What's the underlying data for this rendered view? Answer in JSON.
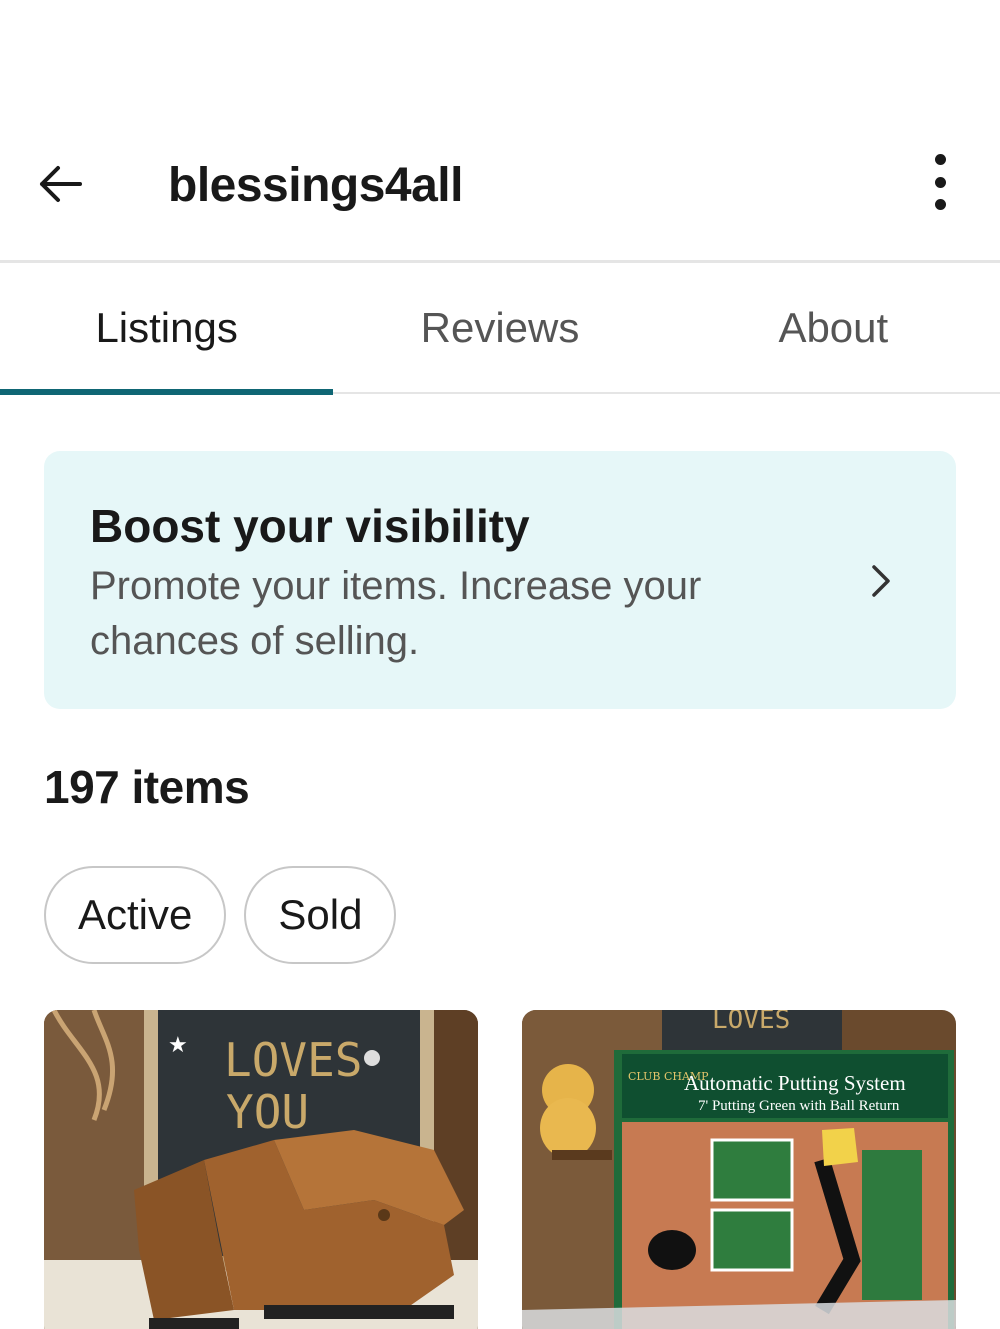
{
  "header": {
    "title": "blessings4all"
  },
  "tabs": [
    {
      "label": "Listings",
      "active": true
    },
    {
      "label": "Reviews",
      "active": false
    },
    {
      "label": "About",
      "active": false
    }
  ],
  "promo": {
    "title": "Boost your visibility",
    "description": "Promote your items. Increase your chances of selling."
  },
  "items": {
    "count_label": "197 items"
  },
  "filters": [
    {
      "label": "Active"
    },
    {
      "label": "Sold"
    }
  ],
  "listings": [
    {
      "image": "brown leather boots in front of letter board",
      "board_text": "LOVES YOU"
    },
    {
      "image": "putting green product box",
      "box_brand": "CLUB CHAMP",
      "box_title": "Automatic Putting System",
      "box_subtitle": "7' Putting Green with Ball Return",
      "board_text": "LOVES YOU"
    }
  ],
  "colors": {
    "accent": "#0f6674",
    "promo_bg": "#e6f7f8",
    "divider": "#e5e5e5"
  }
}
